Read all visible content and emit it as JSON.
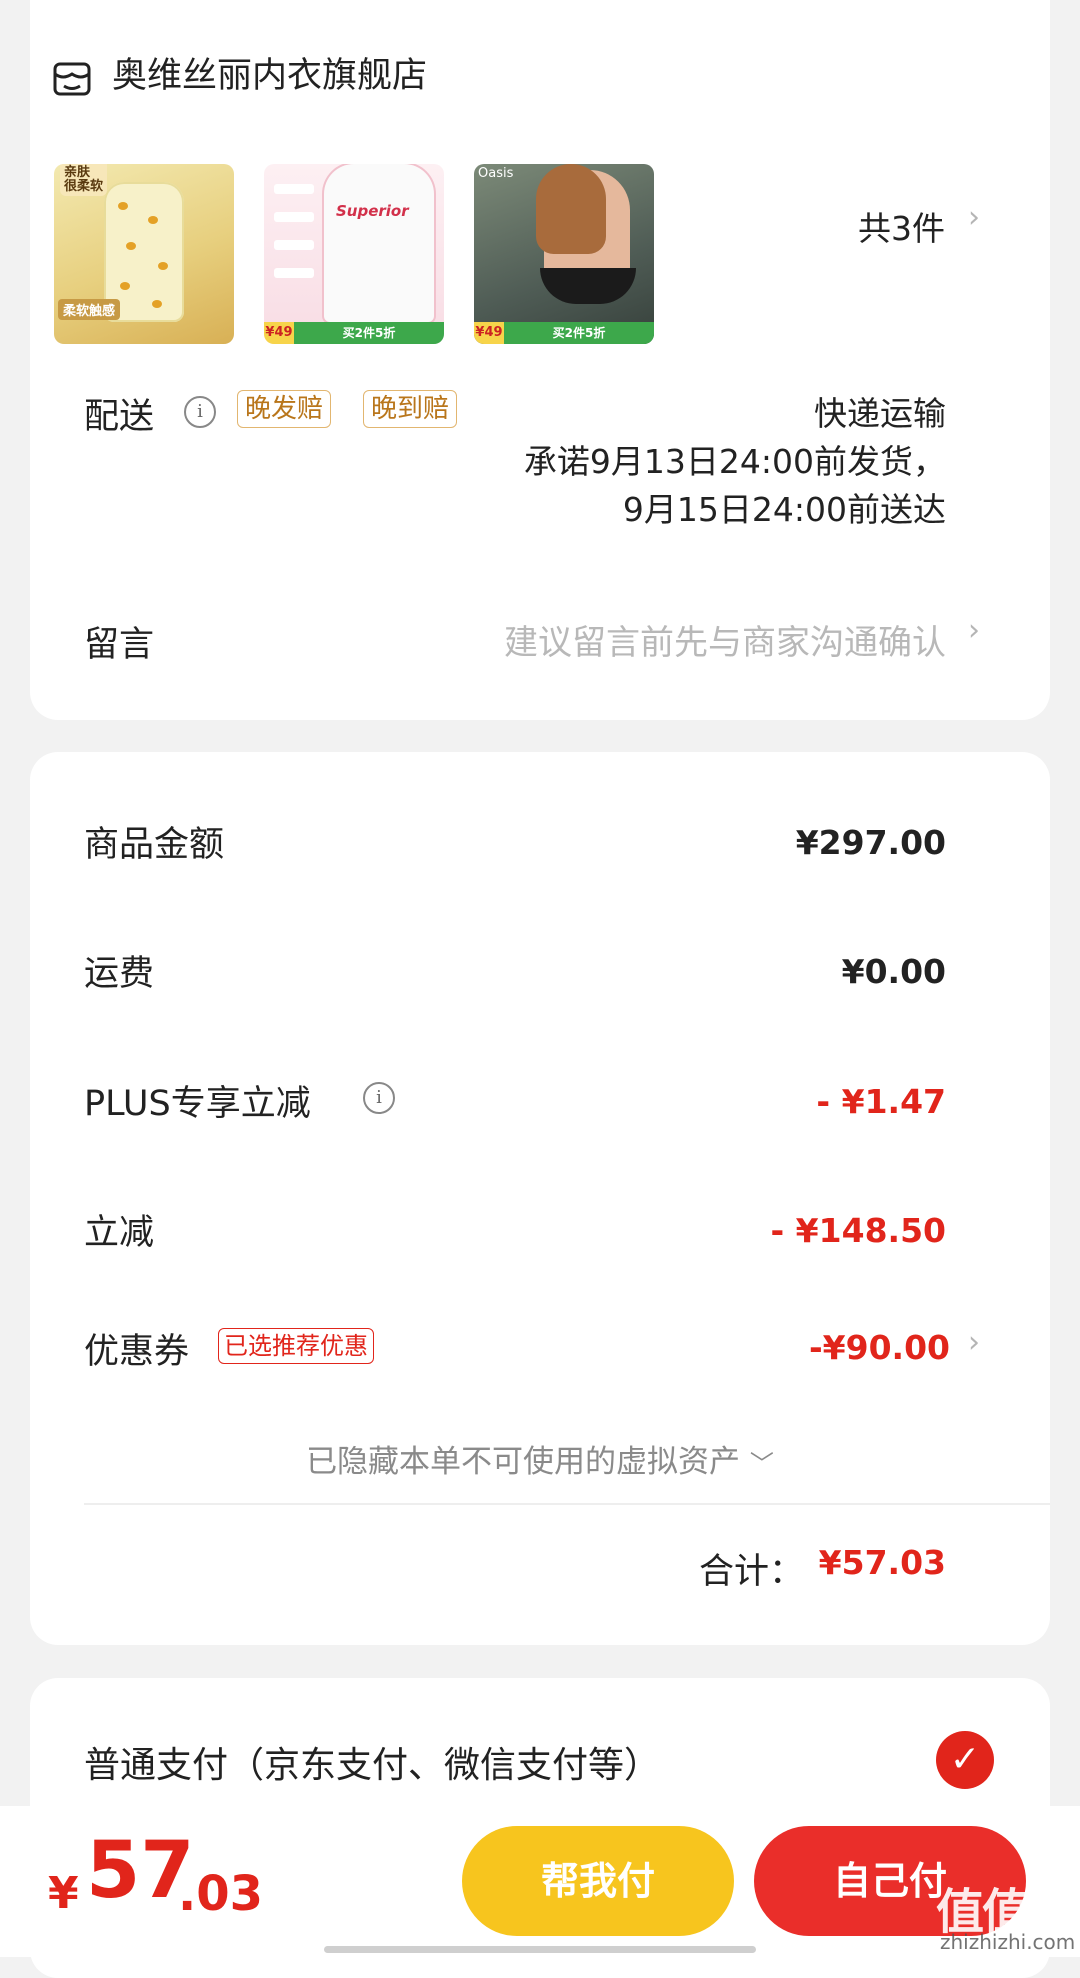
{
  "store": {
    "name": "奥维丝丽内衣旗舰店",
    "icon": "store-icon"
  },
  "products": [
    {
      "badge_top": "亲肤\n很柔软",
      "badge_bottom": "柔软触感"
    },
    {
      "logo": "Superior",
      "promo": "买2件5折",
      "price_badge": "¥49"
    },
    {
      "logo": "Oasis",
      "promo": "买2件5折",
      "price_badge": "¥49"
    }
  ],
  "item_count": "共3件",
  "delivery": {
    "label": "配送",
    "tags": [
      "晚发赔",
      "晚到赔"
    ],
    "method": "快递运输",
    "promise_line1": "承诺9月13日24:00前发货，",
    "promise_line2": "9月15日24:00前送达"
  },
  "message": {
    "label": "留言",
    "placeholder": "建议留言前先与商家沟通确认"
  },
  "summary": {
    "goods_label": "商品金额",
    "goods_value": "¥297.00",
    "shipping_label": "运费",
    "shipping_value": "¥0.00",
    "plus_label": "PLUS专享立减",
    "plus_value": "- ¥1.47",
    "discount_label": "立减",
    "discount_value": "- ¥148.50",
    "coupon_label": "优惠券",
    "coupon_tag": "已选推荐优惠",
    "coupon_value": "-¥90.00",
    "hidden_assets": "已隐藏本单不可使用的虚拟资产",
    "total_label": "合计：",
    "total_value": "¥57.03"
  },
  "payment": {
    "method_label": "普通支付（京东支付、微信支付等）",
    "selected": true
  },
  "bottom": {
    "currency": "¥",
    "amount_int": "57",
    "amount_dec": ".03",
    "help_pay": "帮我付",
    "self_pay": "自己付"
  },
  "watermark": {
    "text": "值值值",
    "sub": "zhizhizhi.com"
  },
  "colors": {
    "accent_red": "#e1251b",
    "help_button": "#f7c51e",
    "tag_orange": "#b9761b"
  }
}
